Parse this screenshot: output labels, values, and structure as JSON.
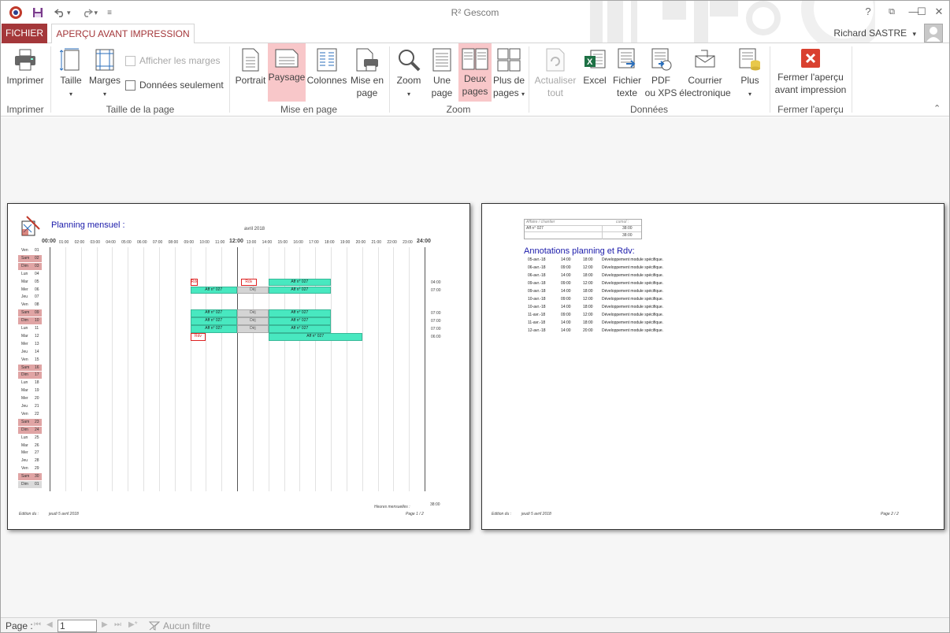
{
  "app": {
    "title": "R² Gescom"
  },
  "window_controls": {
    "help": "?",
    "restore_ribbon": "⧉",
    "minimize": "—",
    "maximize": "☐",
    "close": "✕"
  },
  "tabs": {
    "file": "FICHIER",
    "preview": "APERÇU AVANT IMPRESSION"
  },
  "user": {
    "name": "Richard SASTRE",
    "caret": "▾"
  },
  "ribbon": {
    "groups": {
      "print": "Imprimer",
      "page_size": "Taille de la page",
      "layout": "Mise en page",
      "zoom": "Zoom",
      "data": "Données",
      "close": "Fermer l'aperçu"
    },
    "buttons": {
      "print": "Imprimer",
      "size": "Taille",
      "margins": "Marges",
      "show_margins": "Afficher les marges",
      "data_only": "Données seulement",
      "portrait": "Portrait",
      "landscape": "Paysage",
      "columns": "Colonnes",
      "page_setup_1": "Mise en",
      "page_setup_2": "page",
      "zoom": "Zoom",
      "one_page_1": "Une",
      "one_page_2": "page",
      "two_pages_1": "Deux",
      "two_pages_2": "pages",
      "more_pages_1": "Plus de",
      "more_pages_2": "pages",
      "refresh_1": "Actualiser",
      "refresh_2": "tout",
      "excel": "Excel",
      "text_file_1": "Fichier",
      "text_file_2": "texte",
      "pdf_1": "PDF",
      "pdf_2": "ou XPS",
      "email_1": "Courrier",
      "email_2": "électronique",
      "more": "Plus",
      "close_1": "Fermer l'aperçu",
      "close_2": "avant impression"
    },
    "dropdown_arrow": "▾",
    "collapse": "⌃",
    "excel_badge": "X"
  },
  "page1": {
    "title": "Planning mensuel :",
    "month": "avril 2018",
    "time_labels": [
      "00:00",
      "01:00",
      "02:00",
      "03:00",
      "04:00",
      "05:00",
      "06:00",
      "07:00",
      "08:00",
      "09:00",
      "10:00",
      "11:00",
      "12:00",
      "13:00",
      "14:00",
      "15:00",
      "16:00",
      "17:00",
      "18:00",
      "19:00",
      "20:00",
      "21:00",
      "22:00",
      "23:00",
      "24:00"
    ],
    "days": [
      {
        "d": "Ven",
        "n": "01",
        "we": false
      },
      {
        "d": "Sam",
        "n": "02",
        "we": true
      },
      {
        "d": "Dim",
        "n": "03",
        "we": true
      },
      {
        "d": "Lun",
        "n": "04",
        "we": false
      },
      {
        "d": "Mar",
        "n": "05",
        "we": false
      },
      {
        "d": "Mer",
        "n": "06",
        "we": false
      },
      {
        "d": "Jeu",
        "n": "07",
        "we": false
      },
      {
        "d": "Ven",
        "n": "08",
        "we": false
      },
      {
        "d": "Sam",
        "n": "09",
        "we": true
      },
      {
        "d": "Dim",
        "n": "10",
        "we": true
      },
      {
        "d": "Lun",
        "n": "11",
        "we": false
      },
      {
        "d": "Mar",
        "n": "12",
        "we": false
      },
      {
        "d": "Mer",
        "n": "13",
        "we": false
      },
      {
        "d": "Jeu",
        "n": "14",
        "we": false
      },
      {
        "d": "Ven",
        "n": "15",
        "we": false
      },
      {
        "d": "Sam",
        "n": "16",
        "we": true
      },
      {
        "d": "Dim",
        "n": "17",
        "we": true
      },
      {
        "d": "Lun",
        "n": "18",
        "we": false
      },
      {
        "d": "Mar",
        "n": "19",
        "we": false
      },
      {
        "d": "Mer",
        "n": "20",
        "we": false
      },
      {
        "d": "Jeu",
        "n": "21",
        "we": false
      },
      {
        "d": "Ven",
        "n": "22",
        "we": false
      },
      {
        "d": "Sam",
        "n": "23",
        "we": true
      },
      {
        "d": "Dim",
        "n": "24",
        "we": true
      },
      {
        "d": "Lun",
        "n": "25",
        "we": false
      },
      {
        "d": "Mar",
        "n": "26",
        "we": false
      },
      {
        "d": "Mer",
        "n": "27",
        "we": false
      },
      {
        "d": "Jeu",
        "n": "28",
        "we": false
      },
      {
        "d": "Ven",
        "n": "29",
        "we": false
      },
      {
        "d": "Sam",
        "n": "30",
        "we": true
      },
      {
        "d": "Dim",
        "n": "01",
        "we": "grey"
      }
    ],
    "events": [
      {
        "row": 4,
        "start": 9,
        "end": 9.5,
        "label": "Rdv",
        "type": "rdv"
      },
      {
        "row": 4,
        "start": 12.25,
        "end": 13.25,
        "label": "Rdv",
        "type": "rdv"
      },
      {
        "row": 4,
        "start": 14,
        "end": 18,
        "label": "Aff n° 027",
        "type": "aff"
      },
      {
        "row": 5,
        "start": 9,
        "end": 12,
        "label": "Aff n° 027",
        "type": "aff"
      },
      {
        "row": 5,
        "start": 12,
        "end": 14,
        "label": "Déj",
        "type": "dej"
      },
      {
        "row": 5,
        "start": 14,
        "end": 18,
        "label": "Aff n° 027",
        "type": "aff"
      },
      {
        "row": 8,
        "start": 9,
        "end": 12,
        "label": "Aff n° 027",
        "type": "aff"
      },
      {
        "row": 8,
        "start": 12,
        "end": 14,
        "label": "Déj",
        "type": "dej"
      },
      {
        "row": 8,
        "start": 14,
        "end": 18,
        "label": "Aff n° 027",
        "type": "aff"
      },
      {
        "row": 9,
        "start": 9,
        "end": 12,
        "label": "Aff n° 027",
        "type": "aff"
      },
      {
        "row": 9,
        "start": 12,
        "end": 14,
        "label": "Déj",
        "type": "dej"
      },
      {
        "row": 9,
        "start": 14,
        "end": 18,
        "label": "Aff n° 027",
        "type": "aff"
      },
      {
        "row": 10,
        "start": 9,
        "end": 12,
        "label": "Aff n° 027",
        "type": "aff"
      },
      {
        "row": 10,
        "start": 12,
        "end": 14,
        "label": "Déj",
        "type": "dej"
      },
      {
        "row": 10,
        "start": 14,
        "end": 18,
        "label": "Aff n° 027",
        "type": "aff"
      },
      {
        "row": 11,
        "start": 9,
        "end": 10,
        "label": "Rdv",
        "type": "rdv"
      },
      {
        "row": 11,
        "start": 14,
        "end": 20,
        "label": "Aff n° 027",
        "type": "aff"
      }
    ],
    "row_totals": [
      {
        "row": 4,
        "value": "04:00"
      },
      {
        "row": 5,
        "value": "07:00"
      },
      {
        "row": 8,
        "value": "07:00"
      },
      {
        "row": 9,
        "value": "07:00"
      },
      {
        "row": 10,
        "value": "07:00"
      },
      {
        "row": 11,
        "value": "06:00"
      }
    ],
    "monthly_label": "Heures mensuelles :",
    "monthly_total": "38:00",
    "footer_left": "Edition du :",
    "footer_date": "jeudi 5 avril 2018",
    "footer_page": "Page 1 / 2"
  },
  "page2": {
    "summary": {
      "h1": "Affaire / chantier",
      "h2": "cumul :",
      "row1_label": "Aff n° 027",
      "row1_value": "38:00",
      "total_value": "38:00"
    },
    "title": "Annotations planning  et Rdv:",
    "notes": [
      {
        "date": "05-avr.-18",
        "start": "14:00",
        "end": "18:00",
        "text": "Développement module spécifique."
      },
      {
        "date": "06-avr.-18",
        "start": "09:00",
        "end": "12:00",
        "text": "Développement module spécifique."
      },
      {
        "date": "06-avr.-18",
        "start": "14:00",
        "end": "18:00",
        "text": "Développement module spécifique."
      },
      {
        "date": "09-avr.-18",
        "start": "09:00",
        "end": "12:00",
        "text": "Développement module spécifique."
      },
      {
        "date": "09-avr.-18",
        "start": "14:00",
        "end": "18:00",
        "text": "Développement module spécifique."
      },
      {
        "date": "10-avr.-18",
        "start": "09:00",
        "end": "12:00",
        "text": "Développement module spécifique."
      },
      {
        "date": "10-avr.-18",
        "start": "14:00",
        "end": "18:00",
        "text": "Développement module spécifique."
      },
      {
        "date": "11-avr.-18",
        "start": "09:00",
        "end": "12:00",
        "text": "Développement module spécifique."
      },
      {
        "date": "11-avr.-18",
        "start": "14:00",
        "end": "18:00",
        "text": "Développement module spécifique."
      },
      {
        "date": "12-avr.-18",
        "start": "14:00",
        "end": "20:00",
        "text": "Développement module spécifique."
      }
    ],
    "footer_left": "Edition du :",
    "footer_date": "jeudi 5 avril 2018",
    "footer_page": "Page 2 / 2"
  },
  "statusbar": {
    "page_label": "Page :",
    "page_value": "1",
    "filter": "Aucun filtre"
  },
  "colors": {
    "accent": "#a4373a",
    "active_btn": "#f8c7c9",
    "event": "#48e8c0",
    "dej": "#d4d4d4",
    "weekend": "#e0a4a4",
    "title_blue": "#1a1aaa"
  }
}
